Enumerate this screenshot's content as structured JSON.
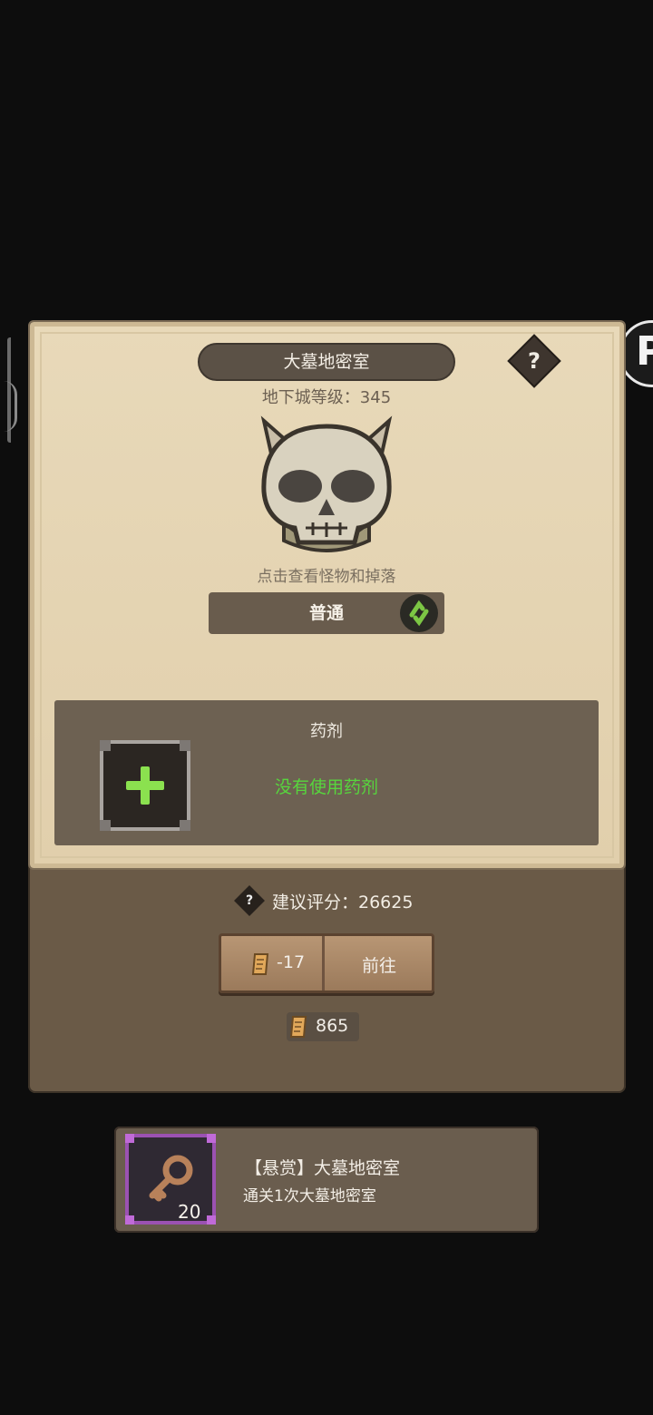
{
  "dungeon": {
    "name": "大墓地密室",
    "level_text": "地下城等级：345",
    "hint": "点击查看怪物和掉落",
    "help_symbol": "?"
  },
  "mode": {
    "label": "普通"
  },
  "potion": {
    "label": "药剂",
    "status": "没有使用药剂"
  },
  "score": {
    "help_symbol": "?",
    "text": "建议评分：26625"
  },
  "enter": {
    "cost": "-17",
    "go_label": "前往"
  },
  "balance": {
    "amount": "865"
  },
  "bounty": {
    "title": "【悬赏】大墓地密室",
    "description": "通关1次大墓地密室",
    "reward_count": "20"
  },
  "side_badge": {
    "letter": "P"
  },
  "colors": {
    "parchment": "#e8d9b9",
    "panel_brown": "#6a5a47",
    "potion_green": "#57d63d",
    "bounty_purple": "#9b52b2"
  },
  "icons": [
    "help-icon",
    "skull-icon",
    "switch-icon",
    "plus-icon",
    "scroll-icon",
    "key-icon"
  ]
}
